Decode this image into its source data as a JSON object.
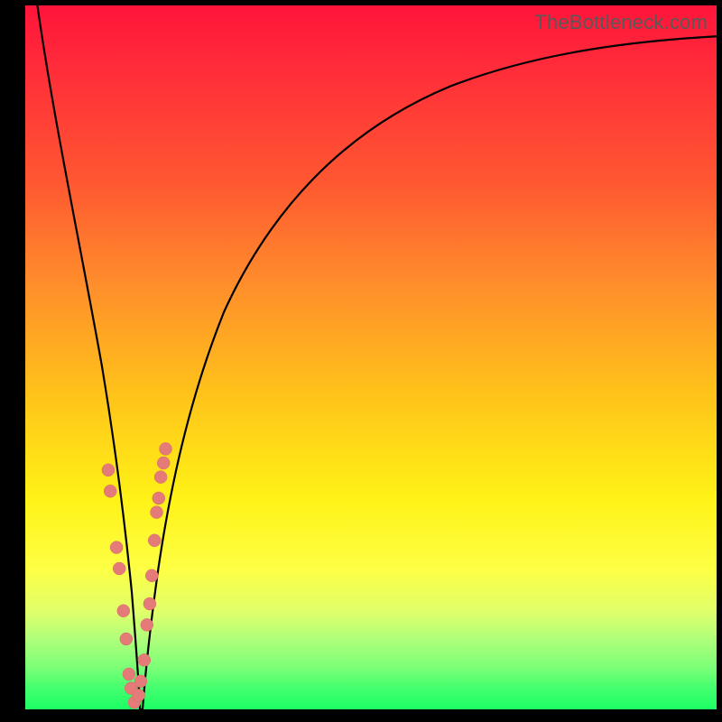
{
  "watermark": "TheBottleneck.com",
  "colors": {
    "frame": "#000000",
    "curve": "#000000",
    "dot_fill": "#e57b79",
    "dot_stroke": "#d76a68",
    "gradient_stops": [
      "#ff143a",
      "#ff2a3a",
      "#ff5731",
      "#ff8f2b",
      "#ffc21a",
      "#fff216",
      "#fdff44",
      "#e1ff6a",
      "#b0ff7a",
      "#7cff77",
      "#43ff6e",
      "#1cff64"
    ]
  },
  "chart_data": {
    "type": "line",
    "title": "",
    "xlabel": "",
    "ylabel": "",
    "xlim": [
      0,
      100
    ],
    "ylim": [
      0,
      100
    ],
    "grid": false,
    "legend": false,
    "series": [
      {
        "name": "bottleneck-curve",
        "x": [
          0,
          2,
          4,
          6,
          8,
          10,
          12,
          14,
          15,
          16,
          17,
          18,
          20,
          22,
          25,
          30,
          35,
          40,
          50,
          60,
          70,
          80,
          90,
          100
        ],
        "y": [
          100,
          90,
          79,
          67,
          54,
          41,
          28,
          14,
          6,
          0,
          6,
          14,
          26,
          36,
          48,
          62,
          71,
          77,
          85,
          89,
          92,
          94,
          95.5,
          96.5
        ]
      }
    ],
    "scatter": [
      {
        "name": "points-left-branch",
        "x": [
          12.0,
          12.3,
          13.2,
          13.6,
          14.2,
          14.6,
          15.0,
          15.3,
          15.8
        ],
        "y": [
          34.0,
          31.0,
          23.0,
          20.0,
          14.0,
          10.0,
          5.0,
          3.0,
          1.0
        ]
      },
      {
        "name": "points-right-branch",
        "x": [
          16.4,
          16.7,
          17.2,
          17.6,
          18.0,
          18.3,
          18.7,
          19.0,
          19.3,
          19.6,
          20.0,
          20.3
        ],
        "y": [
          2.0,
          4.0,
          7.0,
          12.0,
          15.0,
          19.0,
          24.0,
          28.0,
          30.0,
          33.0,
          35.0,
          37.0
        ]
      }
    ]
  }
}
